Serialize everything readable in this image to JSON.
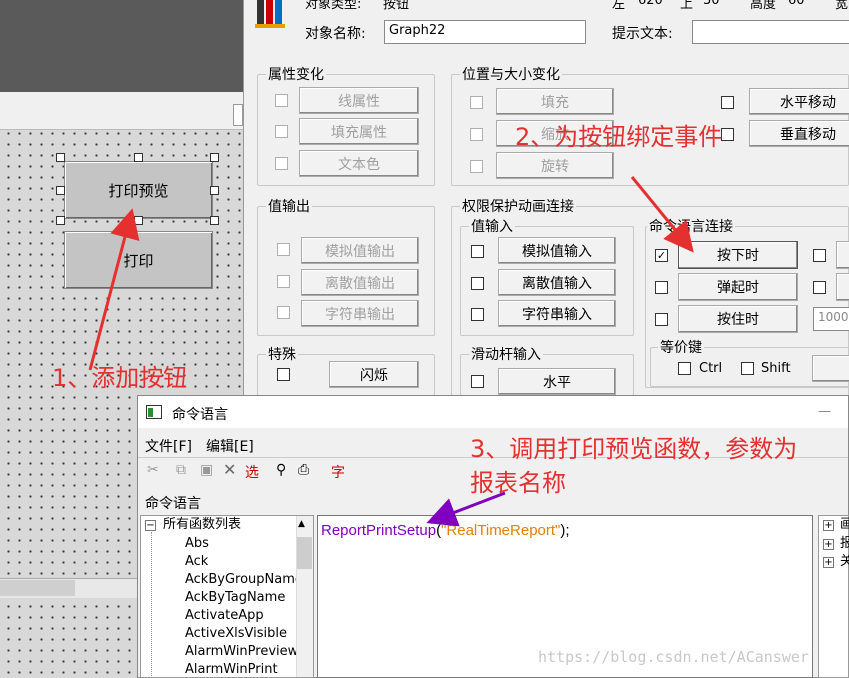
{
  "header": {
    "type_label": "对象类型:",
    "type_value": "按钮",
    "x_label": "左",
    "x_value": "620",
    "y_label": "上",
    "y_value": "30",
    "h_label": "高度",
    "h_value": "60",
    "w_label": "宽"
  },
  "object": {
    "name_label": "对象名称:",
    "name_value": "Graph22",
    "tip_label": "提示文本:",
    "tip_value": ""
  },
  "canvas": {
    "btn_preview": "打印预览",
    "btn_print": "打印"
  },
  "groups": {
    "attr": {
      "title": "属性变化",
      "items": [
        "线属性",
        "填充属性",
        "文本色"
      ]
    },
    "pos": {
      "title": "位置与大小变化",
      "left_items": [
        "填充",
        "缩放",
        "旋转"
      ],
      "right_items": [
        "水平移动",
        "垂直移动"
      ]
    },
    "output": {
      "title": "值输出",
      "items": [
        "模拟值输出",
        "离散值输出",
        "字符串输出"
      ]
    },
    "perm": {
      "title": "权限保护动画连接"
    },
    "input": {
      "title": "值输入",
      "items": [
        "模拟值输入",
        "离散值输入",
        "字符串输入"
      ]
    },
    "cmd": {
      "title": "命令语言连接",
      "items": [
        "按下时",
        "弹起时",
        "按住时"
      ],
      "interval": "1000"
    },
    "equiv": {
      "title": "等价键",
      "ctrl": "Ctrl",
      "shift": "Shift"
    },
    "special": {
      "title": "特殊",
      "items": [
        "闪烁"
      ]
    },
    "slider": {
      "title": "滑动杆输入",
      "items": [
        "水平"
      ]
    }
  },
  "annotations": {
    "a1": "1、添加按钮",
    "a2": "2、为按钮绑定事件",
    "a3_line1": "3、调用打印预览函数，参数为",
    "a3_line2": "报表名称"
  },
  "cmd_window": {
    "title": "命令语言",
    "menu": [
      "文件[F]",
      "编辑[E]"
    ],
    "toolbar_text": "选",
    "toolbar_char": "字",
    "section": "命令语言",
    "tree_root": "所有函数列表",
    "functions": [
      "Abs",
      "Ack",
      "AckByGroupName",
      "AckByTagName",
      "ActivateApp",
      "ActiveXlsVisible",
      "AlarmWinPreview",
      "AlarmWinPrint"
    ],
    "code_func": "ReportPrintSetup",
    "code_open": "(",
    "code_arg": "\"RealTimeReport\"",
    "code_close": ");",
    "right_tree": [
      "画",
      "报",
      "关"
    ]
  },
  "watermark": "https://blog.csdn.net/ACanswer",
  "colors": {
    "annotation": "#e53030",
    "func": "#8000c0",
    "string": "#e08000"
  }
}
